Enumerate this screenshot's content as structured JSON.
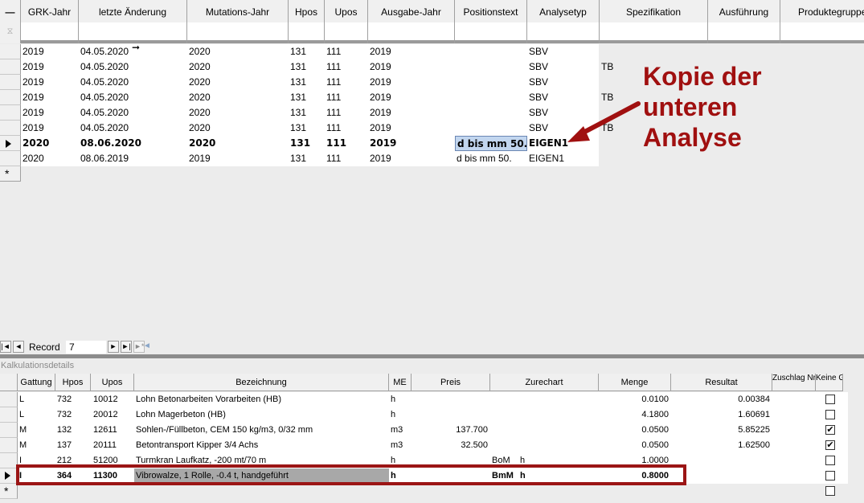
{
  "top_grid": {
    "corner_symbol": "—",
    "filter_icon": "⧖",
    "columns": [
      "GRK-Jahr",
      "letzte Änderung",
      "Mutations-Jahr",
      "Hpos",
      "Upos",
      "Ausgabe-Jahr",
      "Positionstext",
      "Analysetyp",
      "Spezifikation",
      "Ausführung",
      "Produktegruppe"
    ],
    "rows": [
      {
        "grk": "2019",
        "aend": "04.05.2020",
        "mut": "2020",
        "hpos": "131",
        "upos": "111",
        "ausg": "2019",
        "pos": "",
        "typ": "SBV",
        "spez": ""
      },
      {
        "grk": "2019",
        "aend": "04.05.2020",
        "mut": "2020",
        "hpos": "131",
        "upos": "111",
        "ausg": "2019",
        "pos": "",
        "typ": "SBV",
        "spez": "TB"
      },
      {
        "grk": "2019",
        "aend": "04.05.2020",
        "mut": "2020",
        "hpos": "131",
        "upos": "111",
        "ausg": "2019",
        "pos": "",
        "typ": "SBV",
        "spez": ""
      },
      {
        "grk": "2019",
        "aend": "04.05.2020",
        "mut": "2020",
        "hpos": "131",
        "upos": "111",
        "ausg": "2019",
        "pos": "",
        "typ": "SBV",
        "spez": "TB"
      },
      {
        "grk": "2019",
        "aend": "04.05.2020",
        "mut": "2020",
        "hpos": "131",
        "upos": "111",
        "ausg": "2019",
        "pos": "",
        "typ": "SBV",
        "spez": ""
      },
      {
        "grk": "2019",
        "aend": "04.05.2020",
        "mut": "2020",
        "hpos": "131",
        "upos": "111",
        "ausg": "2019",
        "pos": "",
        "typ": "SBV",
        "spez": "TB"
      },
      {
        "grk": "2020",
        "aend": "08.06.2020",
        "mut": "2020",
        "hpos": "131",
        "upos": "111",
        "ausg": "2019",
        "pos": "d bis mm 50.",
        "typ": "EIGEN1",
        "spez": ""
      },
      {
        "grk": "2020",
        "aend": "08.06.2019",
        "mut": "2019",
        "hpos": "131",
        "upos": "111",
        "ausg": "2019",
        "pos": "d bis mm 50.",
        "typ": "EIGEN1",
        "spez": ""
      }
    ],
    "new_row_symbol": "*"
  },
  "annotation": {
    "line1": "Kopie der",
    "line2": "unteren",
    "line3": "Analyse"
  },
  "navigation": {
    "first": "|◄",
    "prev": "◄",
    "label": "Record",
    "current": "7",
    "next": "►",
    "last": "►|",
    "new": "►*",
    "scroll_left": "◄"
  },
  "subform": {
    "title": "Kalkulationsdetails",
    "columns": [
      "Gattung",
      "Hpos",
      "Upos",
      "Bezeichnung",
      "ME",
      "Preis",
      "Zurechart",
      "Menge",
      "Resultat",
      "Zuschlag Nr",
      "Keine GL"
    ],
    "rows": [
      {
        "gattung": "L",
        "hpos": "732",
        "upos": "10012",
        "bez": "Lohn Betonarbeiten Vorarbeiten (HB)",
        "me": "h",
        "preis": "",
        "zur1": "",
        "zur2": "",
        "menge": "0.0100",
        "result": "0.00384",
        "keine_gl": false
      },
      {
        "gattung": "L",
        "hpos": "732",
        "upos": "20012",
        "bez": "Lohn Magerbeton (HB)",
        "me": "h",
        "preis": "",
        "zur1": "",
        "zur2": "",
        "menge": "4.1800",
        "result": "1.60691",
        "keine_gl": false
      },
      {
        "gattung": "M",
        "hpos": "132",
        "upos": "12611",
        "bez": "Sohlen-/Füllbeton, CEM 150 kg/m3,  0/32 mm",
        "me": "m3",
        "preis": "137.700",
        "zur1": "",
        "zur2": "",
        "menge": "0.0500",
        "result": "5.85225",
        "keine_gl": true
      },
      {
        "gattung": "M",
        "hpos": "137",
        "upos": "20111",
        "bez": "Betontransport Kipper 3/4 Achs",
        "me": "m3",
        "preis": "32.500",
        "zur1": "",
        "zur2": "",
        "menge": "0.0500",
        "result": "1.62500",
        "keine_gl": true
      },
      {
        "gattung": "I",
        "hpos": "212",
        "upos": "51200",
        "bez": "Turmkran Laufkatz, -200 mt/70 m",
        "me": "h",
        "preis": "",
        "zur1": "BoM",
        "zur2": "h",
        "menge": "1.0000",
        "result": "",
        "keine_gl": false
      },
      {
        "gattung": "I",
        "hpos": "364",
        "upos": "11300",
        "bez": "Vibrowalze, 1 Rolle, -0.4 t, handgeführt",
        "me": "h",
        "preis": "",
        "zur1": "BmM",
        "zur2": "h",
        "menge": "0.8000",
        "result": "",
        "keine_gl": false
      }
    ],
    "new_row_symbol": "*",
    "checkmark": "✔"
  }
}
